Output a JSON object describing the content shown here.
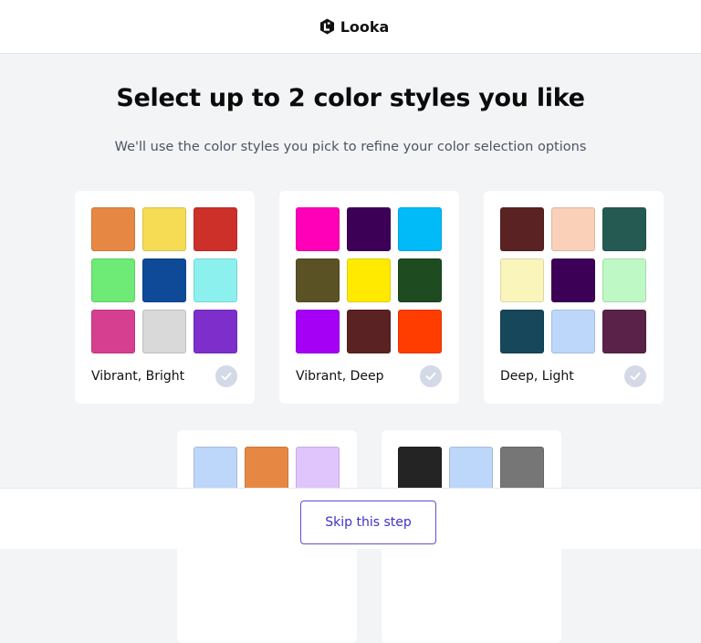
{
  "brand": {
    "name": "Looka",
    "logo_icon": "looka-logo-icon"
  },
  "page": {
    "title": "Select up to 2 color styles you like",
    "subtitle": "We'll use the color styles you pick to refine your color selection options"
  },
  "cards": [
    {
      "label": "Vibrant, Bright",
      "colors": [
        "#e68843",
        "#f6db55",
        "#cd2f29",
        "#6eea76",
        "#0f4a99",
        "#8cf1ee",
        "#d63f8f",
        "#d9d9d9",
        "#7d2ecb"
      ],
      "selected": false
    },
    {
      "label": "Vibrant, Deep",
      "colors": [
        "#ff00b8",
        "#3d0057",
        "#00bbf8",
        "#5a5225",
        "#ffea00",
        "#1e4b20",
        "#a500f5",
        "#5a2222",
        "#ff3d00"
      ],
      "selected": false
    },
    {
      "label": "Deep, Light",
      "colors": [
        "#5a2222",
        "#fad0b8",
        "#245a52",
        "#faf5bb",
        "#3d0057",
        "#bdf8c5",
        "#16475a",
        "#bdd7fa",
        "#5a2249"
      ],
      "selected": false
    },
    {
      "label": "",
      "colors": [
        "#bdd7fa",
        "#e68843",
        "#e0c5fd"
      ],
      "selected": false
    },
    {
      "label": "",
      "colors": [
        "#242424",
        "#bdd7fa",
        "#767676"
      ],
      "selected": false
    }
  ],
  "footer": {
    "skip_label": "Skip this step"
  },
  "colors": {
    "accent": "#3d31c8",
    "check_inactive": "#d3d9e6",
    "page_bg": "#f3f4f6"
  }
}
